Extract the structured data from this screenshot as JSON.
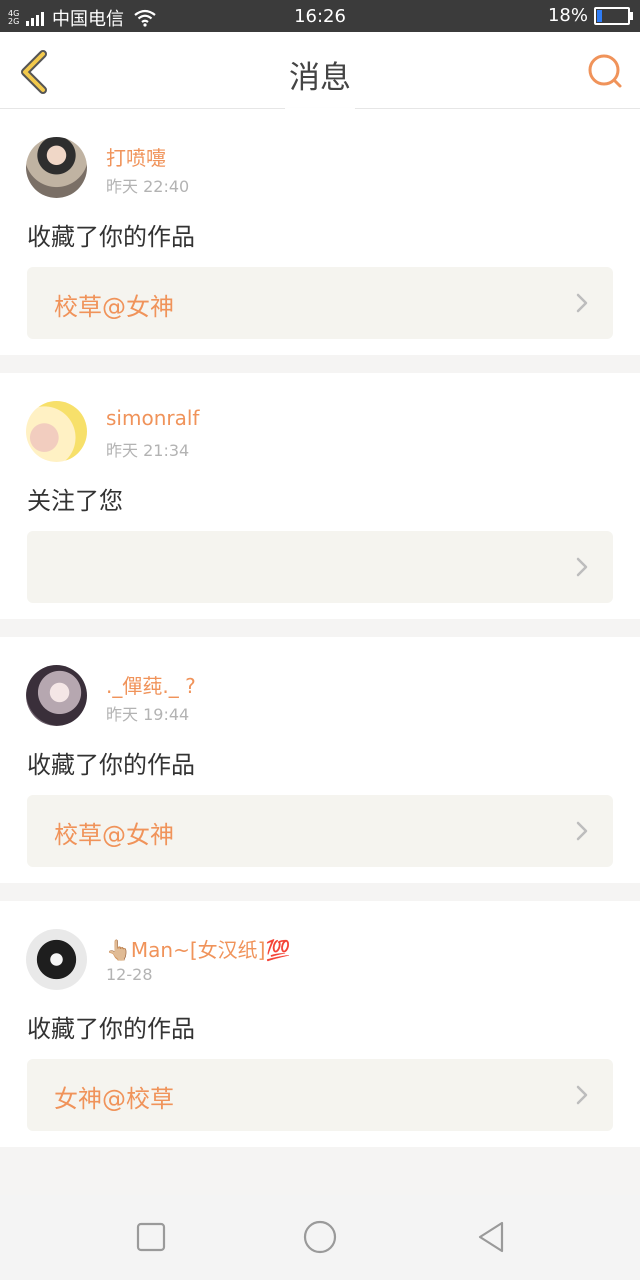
{
  "status_bar": {
    "network_type": "4G 2G",
    "carrier": "中国电信",
    "time": "16:26",
    "battery_percent": "18%",
    "battery_level": 0.18
  },
  "header": {
    "title": "消息"
  },
  "notifications": [
    {
      "username": "打喷嚏",
      "time": "昨天 22:40",
      "action": "收藏了你的作品",
      "work_title": "校草@女神"
    },
    {
      "username": "simonralf",
      "time": "昨天 21:34",
      "action": "关注了您",
      "work_title": ""
    },
    {
      "username": "._僤莼._ ?",
      "time": "昨天 19:44",
      "action": "收藏了你的作品",
      "work_title": "校草@女神"
    },
    {
      "username": "👆🏼Man~[女汉纸]💯",
      "time": "12-28",
      "action": "收藏了你的作品",
      "work_title": "女神@校草"
    }
  ],
  "nav_bar": {
    "buttons": [
      "recent-apps",
      "home",
      "back"
    ]
  },
  "colors": {
    "accent": "#f0935a",
    "back_icon": "#f2c94c",
    "card_box": "#f5f4ef"
  }
}
